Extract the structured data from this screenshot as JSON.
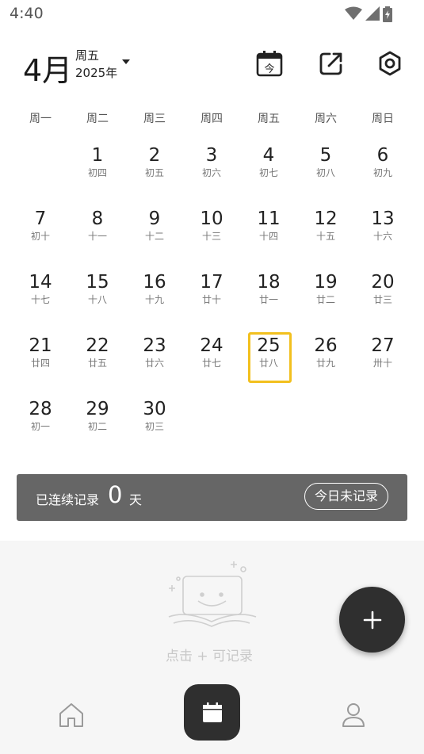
{
  "status": {
    "time": "4:40"
  },
  "header": {
    "month": "4月",
    "weekday": "周五",
    "year": "2025年",
    "today_icon_text": "今"
  },
  "weekdays": [
    "周一",
    "周二",
    "周三",
    "周四",
    "周五",
    "周六",
    "周日"
  ],
  "days": [
    {
      "n": "",
      "l": ""
    },
    {
      "n": "1",
      "l": "初四"
    },
    {
      "n": "2",
      "l": "初五"
    },
    {
      "n": "3",
      "l": "初六"
    },
    {
      "n": "4",
      "l": "初七"
    },
    {
      "n": "5",
      "l": "初八"
    },
    {
      "n": "6",
      "l": "初九"
    },
    {
      "n": "7",
      "l": "初十"
    },
    {
      "n": "8",
      "l": "十一"
    },
    {
      "n": "9",
      "l": "十二"
    },
    {
      "n": "10",
      "l": "十三"
    },
    {
      "n": "11",
      "l": "十四"
    },
    {
      "n": "12",
      "l": "十五"
    },
    {
      "n": "13",
      "l": "十六"
    },
    {
      "n": "14",
      "l": "十七"
    },
    {
      "n": "15",
      "l": "十八"
    },
    {
      "n": "16",
      "l": "十九"
    },
    {
      "n": "17",
      "l": "廿十"
    },
    {
      "n": "18",
      "l": "廿一"
    },
    {
      "n": "19",
      "l": "廿二"
    },
    {
      "n": "20",
      "l": "廿三"
    },
    {
      "n": "21",
      "l": "廿四"
    },
    {
      "n": "22",
      "l": "廿五"
    },
    {
      "n": "23",
      "l": "廿六"
    },
    {
      "n": "24",
      "l": "廿七"
    },
    {
      "n": "25",
      "l": "廿八",
      "today": true
    },
    {
      "n": "26",
      "l": "廿九"
    },
    {
      "n": "27",
      "l": "卅十"
    },
    {
      "n": "28",
      "l": "初一"
    },
    {
      "n": "29",
      "l": "初二"
    },
    {
      "n": "30",
      "l": "初三"
    }
  ],
  "streak": {
    "label": "已连续记录",
    "count": "0",
    "unit": "天",
    "status_button": "今日未记录"
  },
  "empty": {
    "hint": "点击 + 可记录"
  },
  "colors": {
    "today_ring": "#f2c01e",
    "dark": "#2f2f2f",
    "streak_bg": "#666666"
  },
  "icons": {
    "header": [
      "calendar-today-icon",
      "share-icon",
      "settings-icon"
    ],
    "nav": [
      "home-icon",
      "calendar-icon",
      "profile-icon"
    ]
  }
}
